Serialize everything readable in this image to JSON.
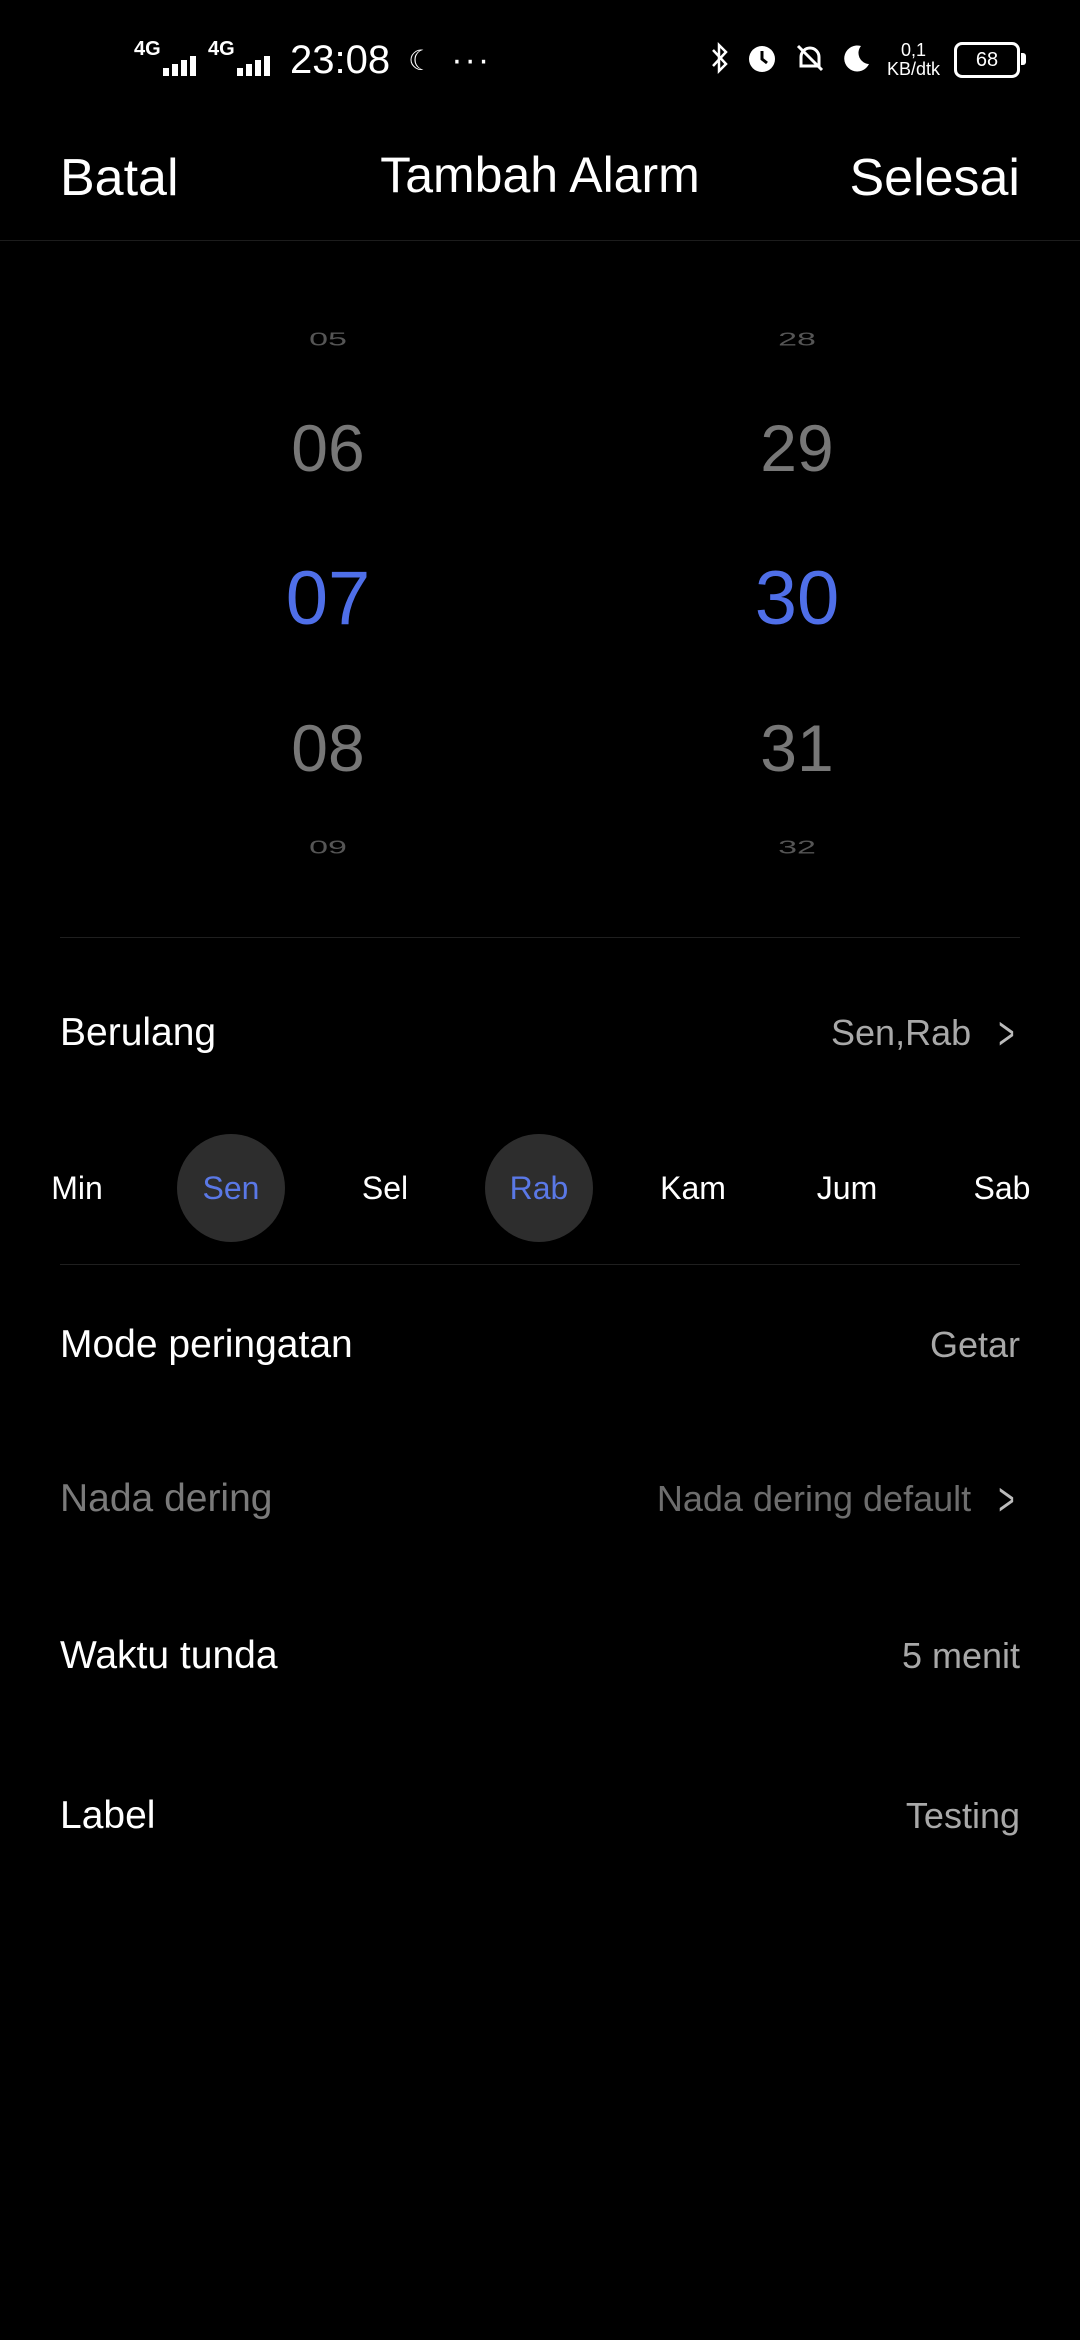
{
  "status_bar": {
    "net1": "4G",
    "net2": "4G",
    "time": "23:08",
    "dots": "···",
    "speed_value": "0,1",
    "speed_unit": "KB/dtk",
    "battery": "68"
  },
  "header": {
    "cancel": "Batal",
    "title": "Tambah Alarm",
    "done": "Selesai"
  },
  "picker": {
    "hours": [
      "05",
      "06",
      "07",
      "08",
      "09"
    ],
    "minutes": [
      "28",
      "29",
      "30",
      "31",
      "32"
    ],
    "selected_hour": "07",
    "selected_minute": "30",
    "accent_color": "#4f6fe8"
  },
  "repeat": {
    "label": "Berulang",
    "value": "Sen,Rab"
  },
  "days": [
    {
      "label": "Min",
      "selected": false
    },
    {
      "label": "Sen",
      "selected": true
    },
    {
      "label": "Sel",
      "selected": false
    },
    {
      "label": "Rab",
      "selected": true
    },
    {
      "label": "Kam",
      "selected": false
    },
    {
      "label": "Jum",
      "selected": false
    },
    {
      "label": "Sab",
      "selected": false
    }
  ],
  "settings": {
    "alert_mode": {
      "label": "Mode peringatan",
      "value": "Getar"
    },
    "ringtone": {
      "label": "Nada dering",
      "value": "Nada dering default"
    },
    "snooze": {
      "label": "Waktu tunda",
      "value": "5 menit"
    },
    "label": {
      "label": "Label",
      "value": "Testing"
    }
  },
  "icons": [
    "signal-icon",
    "moon-icon",
    "bluetooth-icon",
    "alarm-icon",
    "mute-bell-icon",
    "battery-icon",
    "chevron-right-icon"
  ]
}
